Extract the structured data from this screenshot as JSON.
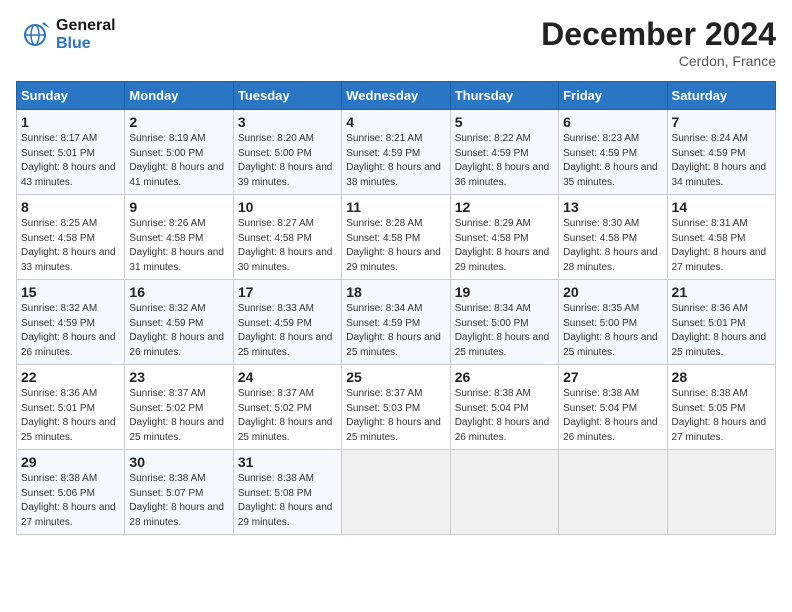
{
  "header": {
    "logo_line1": "General",
    "logo_line2": "Blue",
    "month_title": "December 2024",
    "location": "Cerdon, France"
  },
  "weekdays": [
    "Sunday",
    "Monday",
    "Tuesday",
    "Wednesday",
    "Thursday",
    "Friday",
    "Saturday"
  ],
  "weeks": [
    [
      {
        "day": "1",
        "sunrise": "Sunrise: 8:17 AM",
        "sunset": "Sunset: 5:01 PM",
        "daylight": "Daylight: 8 hours and 43 minutes."
      },
      {
        "day": "2",
        "sunrise": "Sunrise: 8:19 AM",
        "sunset": "Sunset: 5:00 PM",
        "daylight": "Daylight: 8 hours and 41 minutes."
      },
      {
        "day": "3",
        "sunrise": "Sunrise: 8:20 AM",
        "sunset": "Sunset: 5:00 PM",
        "daylight": "Daylight: 8 hours and 39 minutes."
      },
      {
        "day": "4",
        "sunrise": "Sunrise: 8:21 AM",
        "sunset": "Sunset: 4:59 PM",
        "daylight": "Daylight: 8 hours and 38 minutes."
      },
      {
        "day": "5",
        "sunrise": "Sunrise: 8:22 AM",
        "sunset": "Sunset: 4:59 PM",
        "daylight": "Daylight: 8 hours and 36 minutes."
      },
      {
        "day": "6",
        "sunrise": "Sunrise: 8:23 AM",
        "sunset": "Sunset: 4:59 PM",
        "daylight": "Daylight: 8 hours and 35 minutes."
      },
      {
        "day": "7",
        "sunrise": "Sunrise: 8:24 AM",
        "sunset": "Sunset: 4:59 PM",
        "daylight": "Daylight: 8 hours and 34 minutes."
      }
    ],
    [
      {
        "day": "8",
        "sunrise": "Sunrise: 8:25 AM",
        "sunset": "Sunset: 4:58 PM",
        "daylight": "Daylight: 8 hours and 33 minutes."
      },
      {
        "day": "9",
        "sunrise": "Sunrise: 8:26 AM",
        "sunset": "Sunset: 4:58 PM",
        "daylight": "Daylight: 8 hours and 31 minutes."
      },
      {
        "day": "10",
        "sunrise": "Sunrise: 8:27 AM",
        "sunset": "Sunset: 4:58 PM",
        "daylight": "Daylight: 8 hours and 30 minutes."
      },
      {
        "day": "11",
        "sunrise": "Sunrise: 8:28 AM",
        "sunset": "Sunset: 4:58 PM",
        "daylight": "Daylight: 8 hours and 29 minutes."
      },
      {
        "day": "12",
        "sunrise": "Sunrise: 8:29 AM",
        "sunset": "Sunset: 4:58 PM",
        "daylight": "Daylight: 8 hours and 29 minutes."
      },
      {
        "day": "13",
        "sunrise": "Sunrise: 8:30 AM",
        "sunset": "Sunset: 4:58 PM",
        "daylight": "Daylight: 8 hours and 28 minutes."
      },
      {
        "day": "14",
        "sunrise": "Sunrise: 8:31 AM",
        "sunset": "Sunset: 4:58 PM",
        "daylight": "Daylight: 8 hours and 27 minutes."
      }
    ],
    [
      {
        "day": "15",
        "sunrise": "Sunrise: 8:32 AM",
        "sunset": "Sunset: 4:59 PM",
        "daylight": "Daylight: 8 hours and 26 minutes."
      },
      {
        "day": "16",
        "sunrise": "Sunrise: 8:32 AM",
        "sunset": "Sunset: 4:59 PM",
        "daylight": "Daylight: 8 hours and 26 minutes."
      },
      {
        "day": "17",
        "sunrise": "Sunrise: 8:33 AM",
        "sunset": "Sunset: 4:59 PM",
        "daylight": "Daylight: 8 hours and 25 minutes."
      },
      {
        "day": "18",
        "sunrise": "Sunrise: 8:34 AM",
        "sunset": "Sunset: 4:59 PM",
        "daylight": "Daylight: 8 hours and 25 minutes."
      },
      {
        "day": "19",
        "sunrise": "Sunrise: 8:34 AM",
        "sunset": "Sunset: 5:00 PM",
        "daylight": "Daylight: 8 hours and 25 minutes."
      },
      {
        "day": "20",
        "sunrise": "Sunrise: 8:35 AM",
        "sunset": "Sunset: 5:00 PM",
        "daylight": "Daylight: 8 hours and 25 minutes."
      },
      {
        "day": "21",
        "sunrise": "Sunrise: 8:36 AM",
        "sunset": "Sunset: 5:01 PM",
        "daylight": "Daylight: 8 hours and 25 minutes."
      }
    ],
    [
      {
        "day": "22",
        "sunrise": "Sunrise: 8:36 AM",
        "sunset": "Sunset: 5:01 PM",
        "daylight": "Daylight: 8 hours and 25 minutes."
      },
      {
        "day": "23",
        "sunrise": "Sunrise: 8:37 AM",
        "sunset": "Sunset: 5:02 PM",
        "daylight": "Daylight: 8 hours and 25 minutes."
      },
      {
        "day": "24",
        "sunrise": "Sunrise: 8:37 AM",
        "sunset": "Sunset: 5:02 PM",
        "daylight": "Daylight: 8 hours and 25 minutes."
      },
      {
        "day": "25",
        "sunrise": "Sunrise: 8:37 AM",
        "sunset": "Sunset: 5:03 PM",
        "daylight": "Daylight: 8 hours and 25 minutes."
      },
      {
        "day": "26",
        "sunrise": "Sunrise: 8:38 AM",
        "sunset": "Sunset: 5:04 PM",
        "daylight": "Daylight: 8 hours and 26 minutes."
      },
      {
        "day": "27",
        "sunrise": "Sunrise: 8:38 AM",
        "sunset": "Sunset: 5:04 PM",
        "daylight": "Daylight: 8 hours and 26 minutes."
      },
      {
        "day": "28",
        "sunrise": "Sunrise: 8:38 AM",
        "sunset": "Sunset: 5:05 PM",
        "daylight": "Daylight: 8 hours and 27 minutes."
      }
    ],
    [
      {
        "day": "29",
        "sunrise": "Sunrise: 8:38 AM",
        "sunset": "Sunset: 5:06 PM",
        "daylight": "Daylight: 8 hours and 27 minutes."
      },
      {
        "day": "30",
        "sunrise": "Sunrise: 8:38 AM",
        "sunset": "Sunset: 5:07 PM",
        "daylight": "Daylight: 8 hours and 28 minutes."
      },
      {
        "day": "31",
        "sunrise": "Sunrise: 8:38 AM",
        "sunset": "Sunset: 5:08 PM",
        "daylight": "Daylight: 8 hours and 29 minutes."
      },
      null,
      null,
      null,
      null
    ]
  ]
}
